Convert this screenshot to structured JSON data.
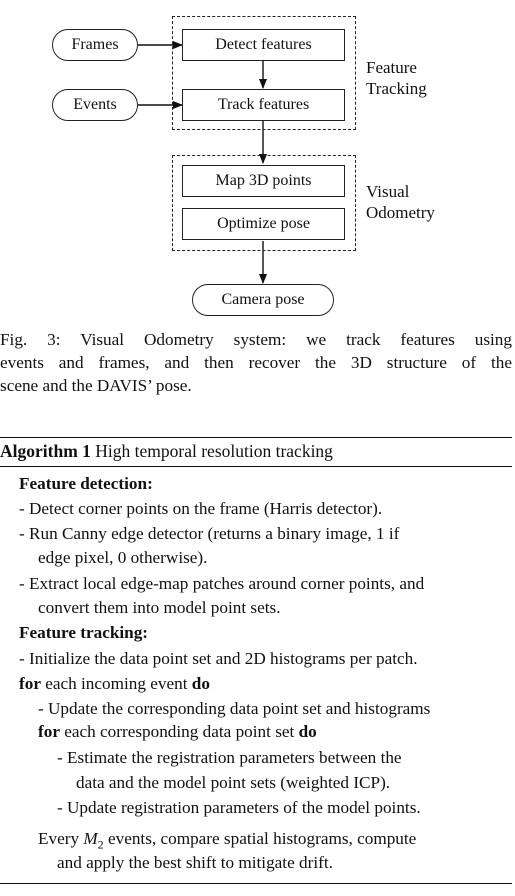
{
  "diagram": {
    "inputs": {
      "frames": "Frames",
      "events": "Events"
    },
    "feature_tracking": {
      "label_line1": "Feature",
      "label_line2": "Tracking",
      "detect": "Detect features",
      "track": "Track features"
    },
    "visual_odometry": {
      "label_line1": "Visual",
      "label_line2": "Odometry",
      "map": "Map 3D points",
      "optimize": "Optimize pose"
    },
    "output": "Camera pose"
  },
  "caption": {
    "line1": "Fig. 3: Visual Odometry system: we track features using",
    "line2": "events and frames, and then recover the 3D structure of the",
    "line3": "scene and the DAVIS’ pose."
  },
  "algorithm": {
    "number": "Algorithm 1",
    "title": "High temporal resolution tracking",
    "feature_detection_heading": "Feature detection:",
    "fd_1": "- Detect corner points on the frame (Harris detector).",
    "fd_2a": "- Run Canny edge detector (returns a binary image, 1 if",
    "fd_2b": "edge pixel, 0 otherwise).",
    "fd_3a": "- Extract local edge-map patches around corner points, and",
    "fd_3b": "convert them into model point sets.",
    "feature_tracking_heading": "Feature tracking:",
    "ft_1": "- Initialize the data point set and 2D histograms per patch.",
    "for_kw": "for",
    "for1_text": "each incoming event",
    "do_kw": "do",
    "loop1_a": "- Update the corresponding data point set and histograms",
    "for2_text": "each corresponding data point set",
    "loop2_a1": "- Estimate the registration parameters between the",
    "loop2_a2": "data and the model point sets (weighted ICP).",
    "loop2_b": "- Update registration parameters of the model points.",
    "every_pre": "Every",
    "every_var": "M",
    "every_sub": "2",
    "every_post": "events, compare spatial histograms, compute",
    "every_line2": "and apply the best shift to mitigate drift."
  }
}
